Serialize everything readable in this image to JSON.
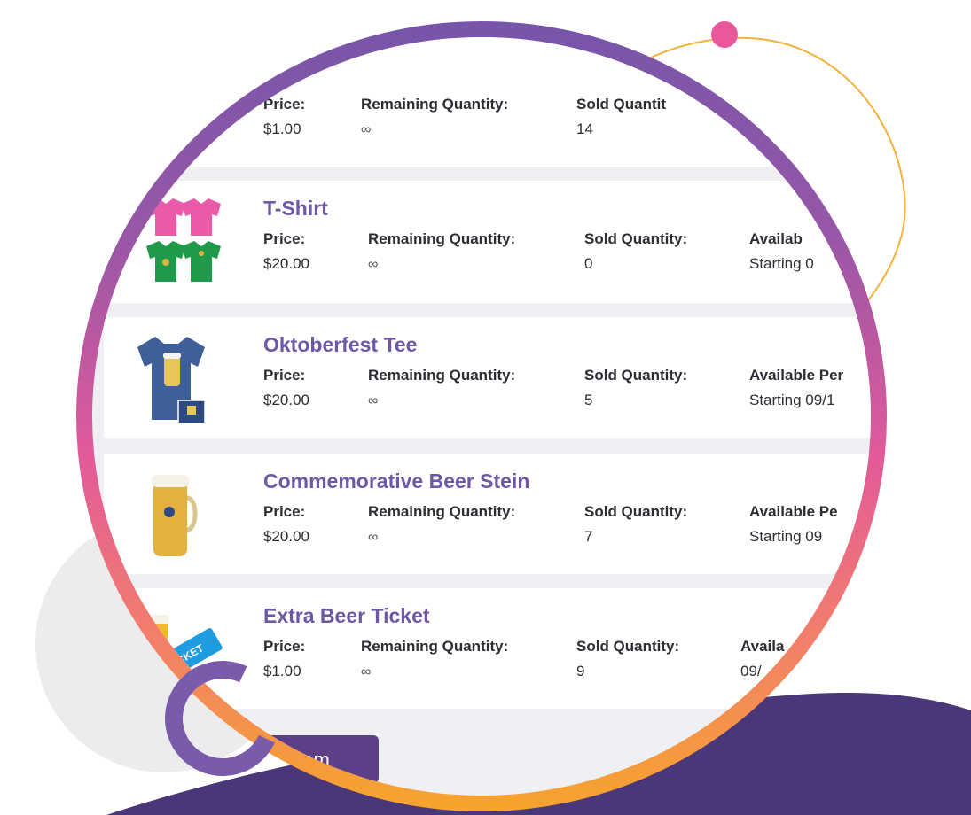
{
  "labels": {
    "price": "Price:",
    "remaining": "Remaining Quantity:",
    "sold": "Sold Quantity:",
    "sold_partial": "Sold Quantit",
    "available": "Availab",
    "available_period": "Available Pe",
    "available_period_b": "Available Per",
    "available_short": "Availa"
  },
  "items": [
    {
      "name": "",
      "price": "$1.00",
      "remaining": "∞",
      "sold": "14",
      "available": ""
    },
    {
      "name": "T-Shirt",
      "price": "$20.00",
      "remaining": "∞",
      "sold": "0",
      "available": "Starting 0"
    },
    {
      "name": "Oktoberfest Tee",
      "price": "$20.00",
      "remaining": "∞",
      "sold": "5",
      "available": "Starting 09/1"
    },
    {
      "name": "Commemorative Beer Stein",
      "price": "$20.00",
      "remaining": "∞",
      "sold": "7",
      "available": "Starting 09"
    },
    {
      "name": "Extra Beer Ticket",
      "price": "$1.00",
      "remaining": "∞",
      "sold": "9",
      "available": "09/"
    }
  ],
  "add_button": {
    "label": "Item"
  },
  "thumb_text": {
    "ticket": "CKET"
  },
  "colors": {
    "title": "#6e58a5",
    "ring_top": "#7655a9",
    "ring_bottom": "#f7a52b",
    "button": "#5c3f86",
    "dot": "#e8589a",
    "wave": "#4a3779"
  },
  "icons": [
    "tshirt-icon",
    "tee-icon",
    "beer-stein-icon",
    "beer-ticket-icon"
  ]
}
